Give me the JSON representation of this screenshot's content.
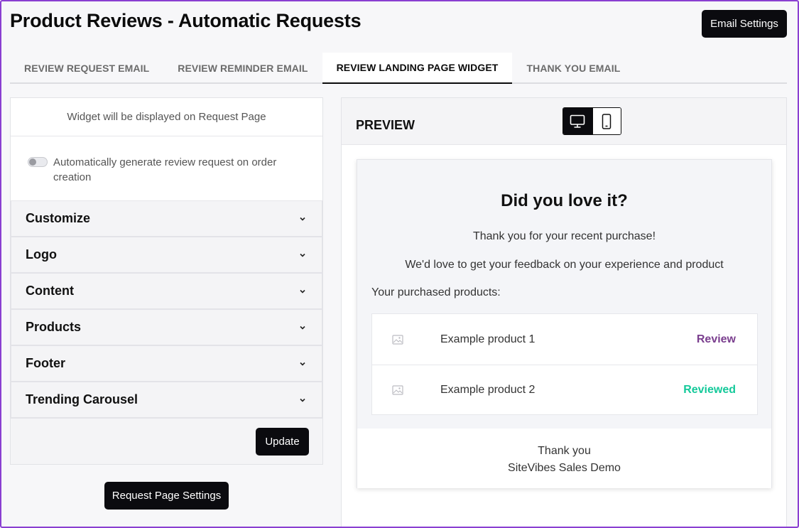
{
  "page": {
    "title": "Product Reviews - Automatic Requests"
  },
  "header": {
    "email_settings_label": "Email Settings"
  },
  "tabs": [
    {
      "label": "REVIEW REQUEST EMAIL",
      "active": false
    },
    {
      "label": "REVIEW REMINDER EMAIL",
      "active": false
    },
    {
      "label": "REVIEW LANDING PAGE WIDGET",
      "active": true
    },
    {
      "label": "THANK YOU EMAIL",
      "active": false
    }
  ],
  "left_panel": {
    "header_text": "Widget will be displayed on Request Page",
    "auto_generate": {
      "label": "Automatically generate review request on order creation",
      "enabled": false
    },
    "sections": [
      {
        "label": "Customize"
      },
      {
        "label": "Logo"
      },
      {
        "label": "Content"
      },
      {
        "label": "Products"
      },
      {
        "label": "Footer"
      },
      {
        "label": "Trending Carousel"
      }
    ],
    "update_label": "Update"
  },
  "request_page_settings_label": "Request Page Settings",
  "preview": {
    "label": "PREVIEW",
    "active_device": "desktop",
    "card": {
      "title": "Did you love it?",
      "line1": "Thank you for your recent purchase!",
      "line2": "We'd love to get your feedback on your experience and product",
      "purchased_label": "Your purchased products:",
      "products": [
        {
          "name": "Example product 1",
          "action": "Review",
          "action_color": "#7a3e8e"
        },
        {
          "name": "Example product 2",
          "action": "Reviewed",
          "action_color": "#14c99a"
        }
      ],
      "footer_line1": "Thank you",
      "footer_line2": "SiteVibes Sales Demo"
    }
  },
  "colors": {
    "frame_border": "#8a3fd1",
    "button_dark": "#0b0b0f"
  }
}
